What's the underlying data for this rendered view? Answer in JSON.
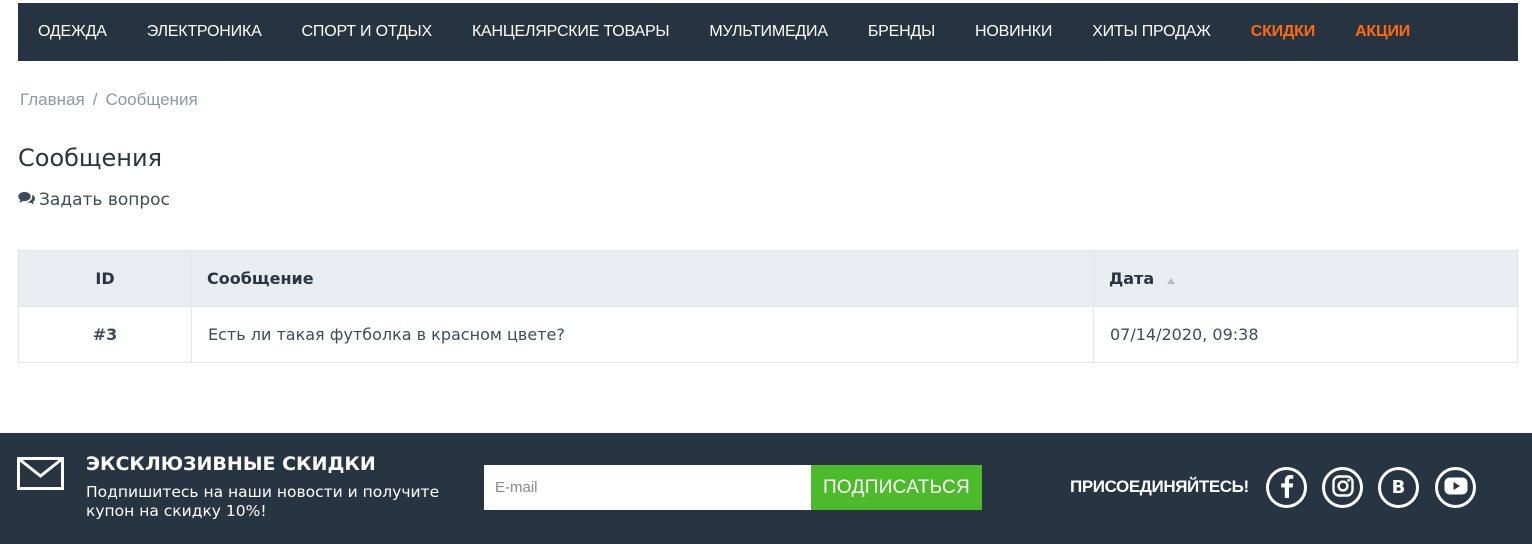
{
  "nav": {
    "items": [
      {
        "label": "ОДЕЖДА"
      },
      {
        "label": "ЭЛЕКТРОНИКА"
      },
      {
        "label": "СПОРТ И ОТДЫХ"
      },
      {
        "label": "КАНЦЕЛЯРСКИЕ ТОВАРЫ"
      },
      {
        "label": "МУЛЬТИМЕДИА"
      },
      {
        "label": "БРЕНДЫ"
      },
      {
        "label": "НОВИНКИ"
      },
      {
        "label": "ХИТЫ ПРОДАЖ"
      },
      {
        "label": "СКИДКИ"
      },
      {
        "label": "АКЦИИ"
      }
    ],
    "accent_color": "#ff6a0f"
  },
  "breadcrumb": {
    "home": "Главная",
    "separator": "/",
    "current": "Сообщения"
  },
  "page": {
    "title": "Сообщения",
    "ask_link": "Задать вопрос"
  },
  "table": {
    "columns": [
      "ID",
      "Сообщение",
      "Дата"
    ],
    "sort_column": "Дата",
    "rows": [
      {
        "id": "#3",
        "message": "Есть ли такая футболка в красном цвете?",
        "date": "07/14/2020, 09:38"
      }
    ]
  },
  "footer": {
    "promo_title": "ЭКСКЛЮЗИВНЫЕ СКИДКИ",
    "promo_text": "Подпишитесь на наши новости и получите купон на скидку 10%!",
    "email_placeholder": "E-mail",
    "subscribe_label": "ПОДПИСАТЬСЯ",
    "join_label": "ПРИСОЕДИНЯЙТЕСЬ!",
    "social": [
      {
        "icon": "facebook-icon"
      },
      {
        "icon": "instagram-icon"
      },
      {
        "icon": "vk-icon",
        "letter": "B"
      },
      {
        "icon": "youtube-icon"
      }
    ],
    "background": "#273441",
    "button_color": "#4cbb2b"
  }
}
